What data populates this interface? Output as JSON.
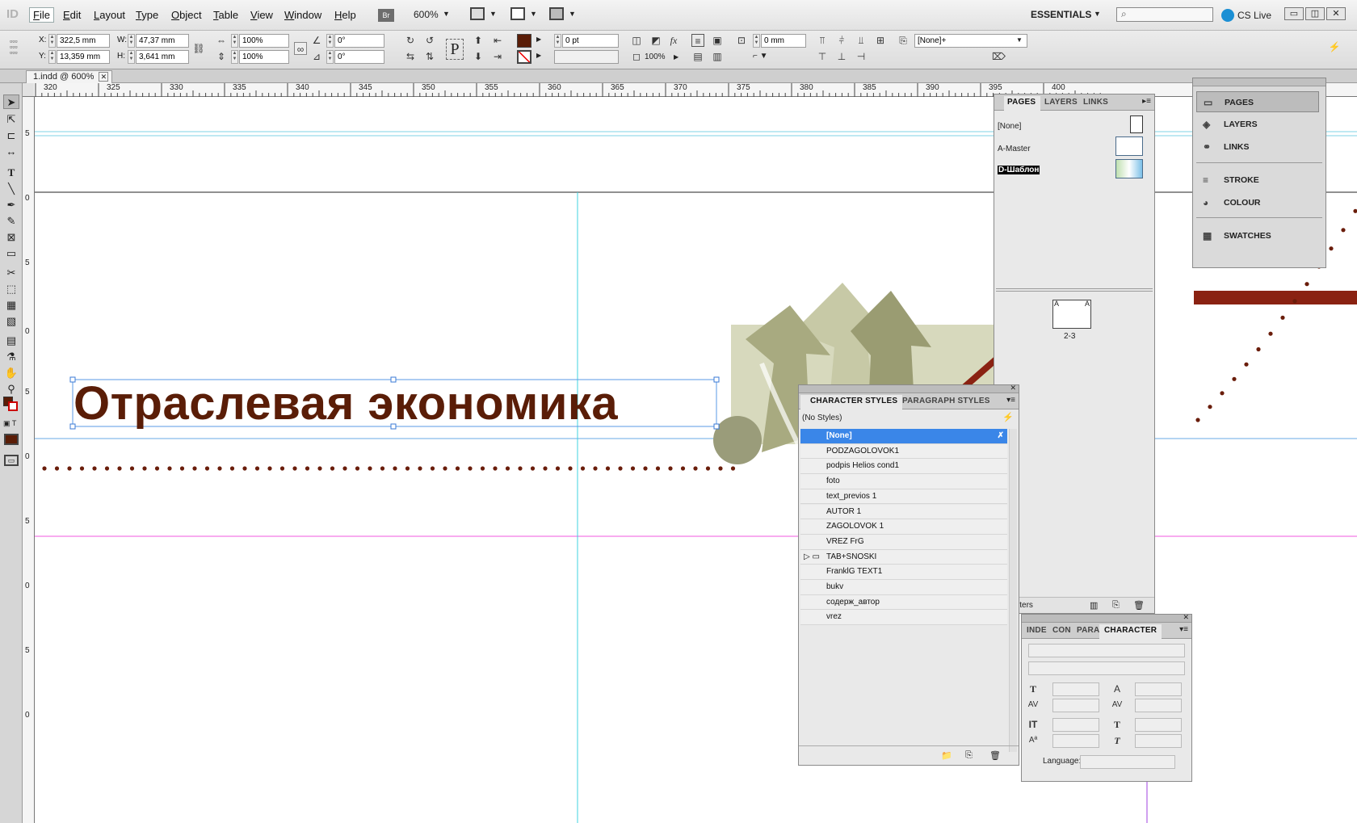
{
  "app": {
    "logo": "ID",
    "zoom": "600%",
    "workspace": "ESSENTIALS",
    "cslive": "CS Live",
    "bridge_label": "Br"
  },
  "menu": [
    "File",
    "Edit",
    "Layout",
    "Type",
    "Object",
    "Table",
    "View",
    "Window",
    "Help"
  ],
  "control": {
    "x_label": "X:",
    "x": "322,5 mm",
    "y_label": "Y:",
    "y": "13,359 mm",
    "w_label": "W:",
    "w": "47,37 mm",
    "h_label": "H:",
    "h": "3,641 mm",
    "scale_x": "100%",
    "scale_y": "100%",
    "rotate": "0°",
    "shear": "0°",
    "stroke_weight": "0 pt",
    "opacity": "100%",
    "offset": "0 mm",
    "object_style": "[None]+",
    "fill_color": "#5a1d07",
    "p_glyph": "P"
  },
  "document_tab": {
    "title": "1.indd @ 600%"
  },
  "ruler_h": [
    "320",
    "325",
    "330",
    "335",
    "340",
    "345",
    "350",
    "355",
    "360",
    "365",
    "370",
    "375",
    "380",
    "385",
    "390",
    "395",
    "400"
  ],
  "ruler_v": [
    "5",
    "0",
    "5",
    "0",
    "5",
    "0",
    "5",
    "0",
    "5",
    "0"
  ],
  "page": {
    "headline": "Отраслевая экономика",
    "headline_color": "#5a1d07"
  },
  "pages_panel": {
    "tabs": [
      "PAGES",
      "LAYERS",
      "LINKS"
    ],
    "masters": [
      "[None]",
      "A-Master",
      "D-Шаблон"
    ],
    "spread_label": "2-3",
    "master_letter": "A",
    "footer": "2 Masters"
  },
  "dock": {
    "group1": [
      "PAGES",
      "LAYERS",
      "LINKS"
    ],
    "group2": [
      "STROKE",
      "COLOUR"
    ],
    "group3": [
      "SWATCHES"
    ]
  },
  "char_styles": {
    "tabs": [
      "CHARACTER STYLES",
      "PARAGRAPH STYLES"
    ],
    "current": "(No Styles)",
    "items": [
      "[None]",
      "PODZAGOLOVOK1",
      "podpis Helios cond1",
      "foto",
      "text_previos 1",
      "AUTOR 1",
      "ZAGOLOVOK 1",
      "VREZ FrG",
      "TAB+SNOSKI",
      "FranklG TEXT1",
      "bukv",
      "содерж_автор",
      "vrez"
    ]
  },
  "character_panel": {
    "tabs": [
      "INDE",
      "CON",
      "PARA",
      "CHARACTER"
    ],
    "language_label": "Language:"
  }
}
